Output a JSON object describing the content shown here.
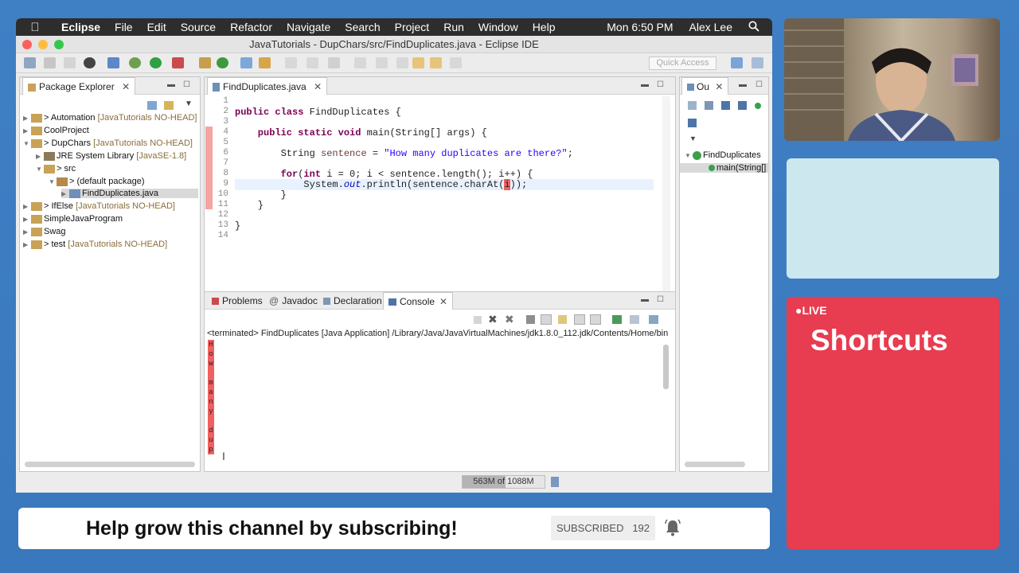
{
  "menubar": {
    "apple": "",
    "items": [
      "Eclipse",
      "File",
      "Edit",
      "Source",
      "Refactor",
      "Navigate",
      "Search",
      "Project",
      "Run",
      "Window",
      "Help"
    ],
    "clock": "Mon 6:50 PM",
    "user": "Alex Lee",
    "search_icon": "search-icon"
  },
  "window": {
    "title": "JavaTutorials - DupChars/src/FindDuplicates.java - Eclipse IDE",
    "quick_access": "Quick Access"
  },
  "package_explorer": {
    "tab": "Package Explorer",
    "items": [
      {
        "label": "> Automation",
        "suffix": " [JavaTutorials NO-HEAD]"
      },
      {
        "label": "CoolProject",
        "suffix": ""
      },
      {
        "label": "> DupChars",
        "suffix": " [JavaTutorials NO-HEAD]"
      },
      {
        "label": "JRE System Library",
        "suffix": " [JavaSE-1.8]"
      },
      {
        "label": "> src",
        "suffix": ""
      },
      {
        "label": "> (default package)",
        "suffix": ""
      },
      {
        "label": "FindDuplicates.java",
        "suffix": ""
      },
      {
        "label": "> IfElse",
        "suffix": " [JavaTutorials NO-HEAD]"
      },
      {
        "label": "SimpleJavaProgram",
        "suffix": ""
      },
      {
        "label": "Swag",
        "suffix": ""
      },
      {
        "label": "> test",
        "suffix": " [JavaTutorials NO-HEAD]"
      }
    ]
  },
  "editor": {
    "tab": "FindDuplicates.java",
    "line_numbers": [
      "1",
      "2",
      "3",
      "4",
      "5",
      "6",
      "7",
      "8",
      "9",
      "10",
      "11",
      "12",
      "13",
      "14"
    ],
    "lines": {
      "l2a": "public class",
      "l2b": " FindDuplicates {",
      "l4a": "    public static void",
      "l4b": " main(String[] args) {",
      "l6a": "        String ",
      "l6b": "sentence",
      "l6c": " = ",
      "l6d": "\"How many duplicates are there?\"",
      "l6e": ";",
      "l8a": "        for",
      "l8b": "(",
      "l8c": "int",
      "l8d": " i = 0; i < sentence.length(); i++) {",
      "l9a": "            System.",
      "l9b": "out",
      "l9c": ".println(sentence.charAt(",
      "l9d": "i",
      "l9e": "));",
      "l10": "        }",
      "l11": "    }",
      "l13": "}"
    }
  },
  "outline": {
    "tab": "Ou",
    "class": "FindDuplicates",
    "method": "main(String[]"
  },
  "bottom_tabs": {
    "problems": "Problems",
    "javadoc": "Javadoc",
    "declaration": "Declaration",
    "console": "Console"
  },
  "console": {
    "header": "<terminated> FindDuplicates [Java Application] /Library/Java/JavaVirtualMachines/jdk1.8.0_112.jdk/Contents/Home/bin",
    "output": [
      "H",
      "o",
      "w",
      " ",
      "m",
      "a",
      "n",
      "y",
      " ",
      "d",
      "u",
      "p"
    ]
  },
  "status": {
    "memory": "563M of 1088M",
    "memory_used_fraction": 0.52
  },
  "overlay": {
    "live": "●LIVE",
    "shortcuts": "Shortcuts",
    "subscribe_text": "Help grow this channel by subscribing!",
    "subscribed_label": "SUBSCRIBED",
    "subscriber_count": "192"
  },
  "colors": {
    "accent_red": "#e83c50",
    "panel_cyan": "#cde7ee",
    "background_blue": "#3f7fc4"
  }
}
